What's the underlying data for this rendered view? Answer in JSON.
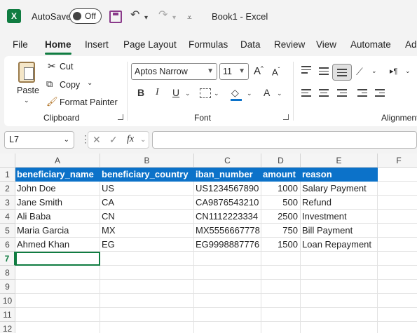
{
  "titlebar": {
    "logo": "X",
    "autosave_label": "AutoSave",
    "toggle_state": "Off",
    "doc_title": "Book1  -  Excel",
    "icons": [
      "excel-logo-icon",
      "save-icon",
      "undo-icon",
      "redo-icon",
      "customize-qat-icon"
    ]
  },
  "menu": {
    "tabs": [
      "File",
      "Home",
      "Insert",
      "Page Layout",
      "Formulas",
      "Data",
      "Review",
      "View",
      "Automate",
      "Ad"
    ],
    "active": "Home"
  },
  "ribbon": {
    "clipboard": {
      "paste": "Paste",
      "cut": "Cut",
      "copy": "Copy",
      "format_painter": "Format Painter",
      "label": "Clipboard"
    },
    "font": {
      "name": "Aptos Narrow",
      "size": "11",
      "label": "Font",
      "bold": "B",
      "italic": "I",
      "underline": "U"
    },
    "alignment": {
      "label": "Alignment"
    }
  },
  "formula_bar": {
    "name_box": "L7",
    "fx": "fx",
    "value": ""
  },
  "sheet": {
    "columns": [
      "A",
      "B",
      "C",
      "D",
      "E",
      "F"
    ],
    "rows": [
      "1",
      "2",
      "3",
      "4",
      "5",
      "6",
      "7",
      "8",
      "9",
      "10",
      "11",
      "12"
    ],
    "header": [
      "beneficiary_name",
      "beneficiary_country",
      "iban_number",
      "amount",
      "reason"
    ],
    "data": [
      [
        "John Doe",
        "US",
        "US1234567890",
        "1000",
        "Salary Payment"
      ],
      [
        "Jane Smith",
        "CA",
        "CA9876543210",
        "500",
        "Refund"
      ],
      [
        "Ali Baba",
        "CN",
        "CN1112223334",
        "2500",
        "Investment"
      ],
      [
        "Maria Garcia",
        "MX",
        "MX5556667778",
        "750",
        "Bill Payment"
      ],
      [
        "Ahmed Khan",
        "EG",
        "EG9998887776",
        "1500",
        "Loan Repayment"
      ]
    ],
    "selected_row": "7",
    "colors": {
      "header_fill": "#0c72c9",
      "accent": "#107c41"
    }
  }
}
